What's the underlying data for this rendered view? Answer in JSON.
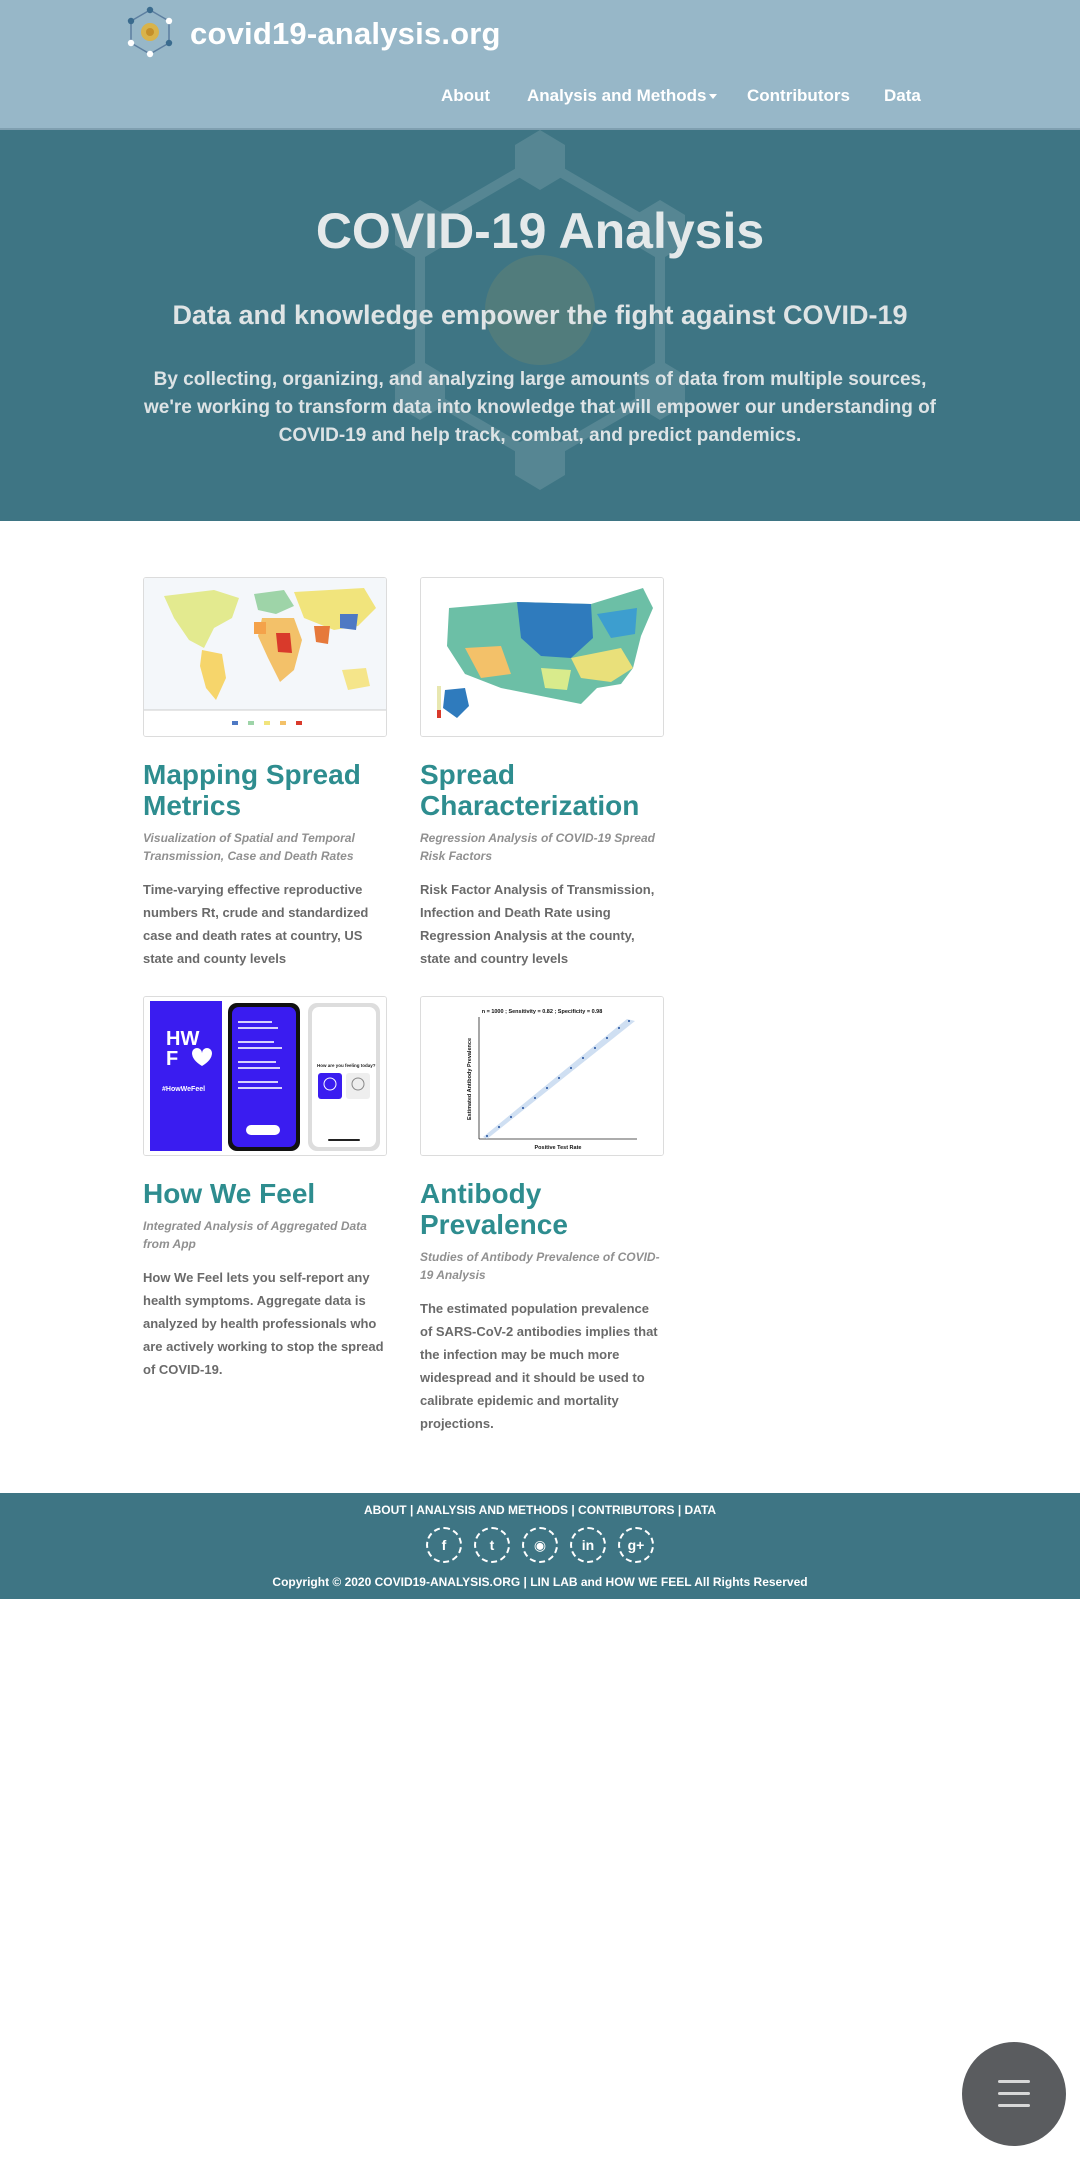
{
  "header": {
    "site_name": "covid19-analysis.org",
    "nav": [
      {
        "label": "About"
      },
      {
        "label": "Analysis and Methods",
        "has_dropdown": true
      },
      {
        "label": "Contributors"
      },
      {
        "label": "Data"
      }
    ]
  },
  "hero": {
    "title": "COVID-19 Analysis",
    "subtitle": "Data and knowledge empower the fight against COVID-19",
    "description": "By collecting, organizing, and analyzing large amounts of data from multiple sources, we're working to transform data into knowledge that will empower our understanding of COVID-19 and help track, combat, and predict pandemics."
  },
  "cards": [
    {
      "title": "Mapping Spread Metrics",
      "subtitle": "Visualization of Spatial and Temporal Transmission, Case and Death Rates",
      "description": "Time-varying effective reproductive numbers Rt, crude and standardized case and death rates at country, US state and county levels",
      "image_icon": "world-map-image"
    },
    {
      "title": "Spread Characterization",
      "subtitle": "Regression Analysis of COVID-19 Spread Risk Factors",
      "description": "Risk Factor Analysis of Transmission, Infection and Death Rate using Regression Analysis at the county, state and country levels",
      "image_icon": "us-county-map-image"
    },
    {
      "title": "How We Feel",
      "subtitle": "Integrated Analysis of Aggregated Data from App",
      "description": "How We Feel lets you self-report any health symptoms. Aggregate data is analyzed by health professionals who are actively working to stop the spread of COVID-19.",
      "image_icon": "app-screens-image",
      "image_text": {
        "logo_line1": "HW",
        "logo_line2": "F",
        "hashtag": "#HowWeFeel",
        "question": "How are you feeling today?"
      }
    },
    {
      "title": "Antibody Prevalence",
      "subtitle": "Studies of Antibody Prevalence of COVID-19 Analysis",
      "description": "The estimated population prevalence of SARS-CoV-2 antibodies implies that the infection may be much more widespread and it should be used to calibrate epidemic and mortality projections.",
      "image_icon": "scatter-plot-image",
      "image_text": {
        "plot_title": "n = 1000 ; Sensitivity = 0.82 ; Specificity = 0.98",
        "xlabel": "Positive Test Rate",
        "ylabel": "Estimated Antibody Prevalence"
      }
    }
  ],
  "footer": {
    "links": [
      "ABOUT",
      "ANALYSIS AND METHODS",
      "CONTRIBUTORS",
      "DATA"
    ],
    "separator": " | ",
    "socials": [
      {
        "icon": "facebook-icon",
        "glyph": "f"
      },
      {
        "icon": "twitter-icon",
        "glyph": "t"
      },
      {
        "icon": "github-icon",
        "glyph": "◉"
      },
      {
        "icon": "linkedin-icon",
        "glyph": "in"
      },
      {
        "icon": "google-plus-icon",
        "glyph": "g+"
      }
    ],
    "copyright": "Copyright © 2020 COVID19-ANALYSIS.ORG | LIN LAB and HOW WE FEEL All Rights Reserved"
  },
  "colors": {
    "topbar": "#97b7c8",
    "hero": "#3e7584",
    "accent": "#2e8d8f",
    "footer": "#3e7584",
    "fab": "#5a5c5f"
  },
  "fab": {
    "icon": "hamburger-menu-icon"
  }
}
